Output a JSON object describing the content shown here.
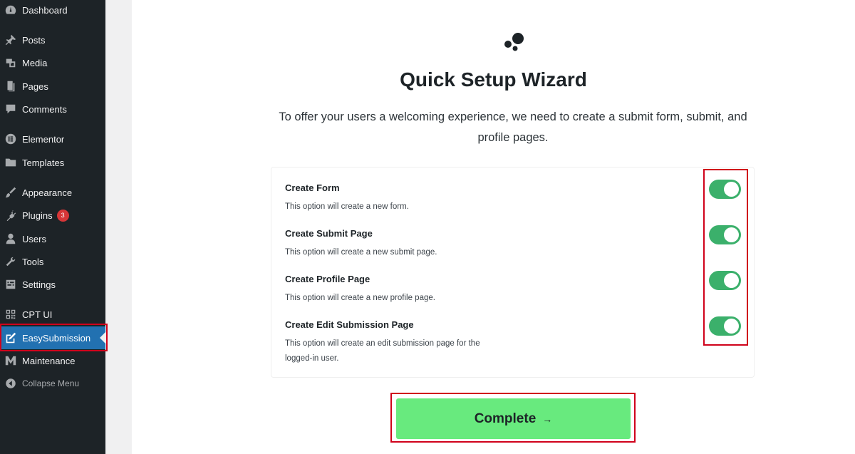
{
  "sidebar": {
    "items": [
      {
        "label": "Dashboard",
        "icon": "dashboard-icon"
      },
      {
        "label": "Posts",
        "icon": "pin-icon"
      },
      {
        "label": "Media",
        "icon": "media-icon"
      },
      {
        "label": "Pages",
        "icon": "pages-icon"
      },
      {
        "label": "Comments",
        "icon": "comment-icon"
      },
      {
        "label": "Elementor",
        "icon": "elementor-icon"
      },
      {
        "label": "Templates",
        "icon": "folder-icon"
      },
      {
        "label": "Appearance",
        "icon": "brush-icon"
      },
      {
        "label": "Plugins",
        "icon": "plug-icon",
        "badge": "3"
      },
      {
        "label": "Users",
        "icon": "user-icon"
      },
      {
        "label": "Tools",
        "icon": "wrench-icon"
      },
      {
        "label": "Settings",
        "icon": "settings-icon"
      },
      {
        "label": "CPT UI",
        "icon": "grid-icon"
      },
      {
        "label": "EasySubmission",
        "icon": "edit-icon",
        "active": true
      },
      {
        "label": "Maintenance",
        "icon": "m-icon"
      },
      {
        "label": "Collapse Menu",
        "icon": "collapse-icon"
      }
    ]
  },
  "wizard": {
    "title": "Quick Setup Wizard",
    "description": "To offer your users a welcoming experience, we need to create a submit form, submit, and profile pages.",
    "options": [
      {
        "title": "Create Form",
        "desc": "This option will create a new form.",
        "enabled": true
      },
      {
        "title": "Create Submit Page",
        "desc": "This option will create a new submit page.",
        "enabled": true
      },
      {
        "title": "Create Profile Page",
        "desc": "This option will create a new profile page.",
        "enabled": true
      },
      {
        "title": "Create Edit Submission Page",
        "desc": "This option will create an edit submission page for the logged-in user.",
        "enabled": true
      }
    ],
    "complete_label": "Complete",
    "complete_arrow": "→"
  },
  "colors": {
    "sidebar_bg": "#1d2327",
    "active_bg": "#2271b1",
    "toggle_on": "#3bb06b",
    "complete_bg": "#68ea7e",
    "highlight": "#d0021b"
  }
}
